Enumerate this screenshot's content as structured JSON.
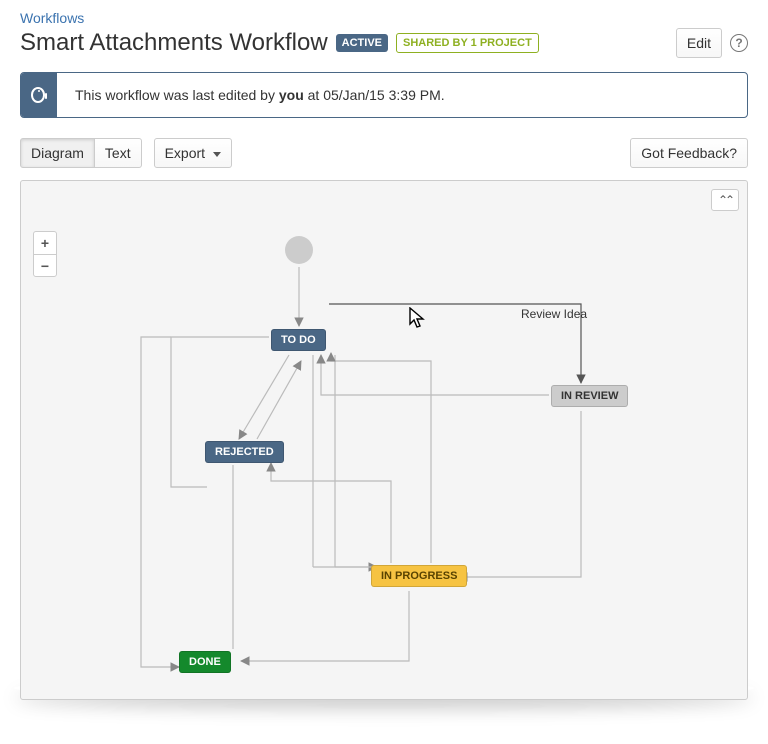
{
  "breadcrumb": {
    "label": "Workflows"
  },
  "title": "Smart Attachments Workflow",
  "badges": {
    "active": "ACTIVE",
    "shared_prefix": "SHARED BY ",
    "shared_count": "1",
    "shared_suffix": " PROJECT"
  },
  "actions": {
    "edit": "Edit"
  },
  "info": {
    "prefix": "This workflow was last edited by ",
    "who": "you",
    "middle": " at ",
    "when": "05/Jan/15 3:39 PM",
    "suffix": "."
  },
  "tabs": {
    "diagram": "Diagram",
    "text": "Text",
    "export": "Export"
  },
  "feedback": "Got Feedback?",
  "zoom": {
    "in": "+",
    "out": "−"
  },
  "nodes": {
    "todo": "TO DO",
    "rejected": "REJECTED",
    "in_review": "IN REVIEW",
    "in_progress": "IN PROGRESS",
    "done": "DONE"
  },
  "edge_labels": {
    "review_idea": "Review Idea"
  }
}
